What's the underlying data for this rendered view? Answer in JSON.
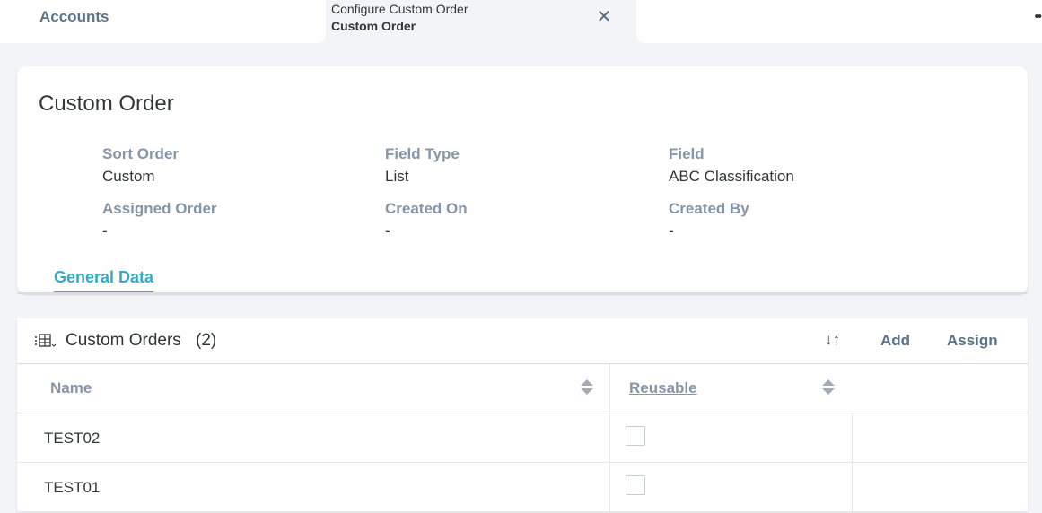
{
  "tabs": {
    "accounts_label": "Accounts",
    "active_subtitle": "Configure Custom Order",
    "active_title": "Custom Order",
    "close_glyph": "✕",
    "overflow_glyph": "••"
  },
  "header": {
    "title": "Custom Order",
    "attributes": [
      {
        "label": "Sort Order",
        "value": "Custom"
      },
      {
        "label": "Field Type",
        "value": "List"
      },
      {
        "label": "Field",
        "value": "ABC Classification"
      },
      {
        "label": "Assigned Order",
        "value": "-"
      },
      {
        "label": "Created On",
        "value": "-"
      },
      {
        "label": "Created By",
        "value": "-"
      }
    ],
    "section_tab": "General Data"
  },
  "table": {
    "title": "Custom Orders",
    "count": "(2)",
    "toolbar": {
      "sort_icon": "↓↑",
      "add_label": "Add",
      "assign_label": "Assign"
    },
    "columns": [
      "Name",
      "Reusable"
    ],
    "rows": [
      {
        "name": "TEST02",
        "reusable": false
      },
      {
        "name": "TEST01",
        "reusable": false
      }
    ]
  },
  "icons": {
    "table_settings_icon": "table-settings-icon",
    "close_icon": "close-icon",
    "sort_icon": "sort-icon",
    "overflow_icon": "overflow-icon"
  },
  "colors": {
    "accent": "#2eaec4",
    "label_gray": "#8696a9",
    "text": "#32363a",
    "button_text": "#5b738b",
    "background": "#f3f4f7"
  }
}
